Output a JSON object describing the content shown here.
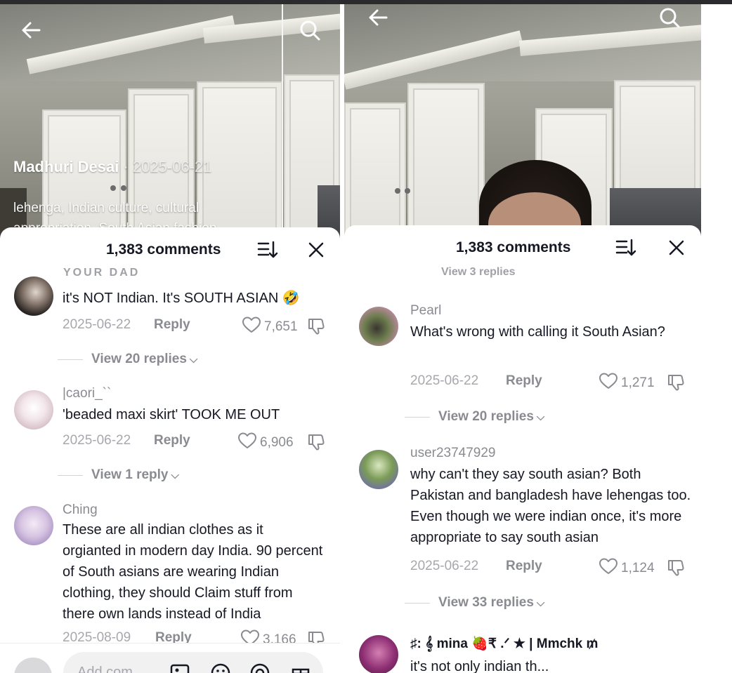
{
  "colors": {
    "accent_text": "#161823",
    "muted_text": "#8a8b91",
    "meta_text": "#a7a8ad",
    "sheet_bg": "#ffffff"
  },
  "left": {
    "video": {
      "author": "Madhuri Desai",
      "date": "· 2025-06-21",
      "tags": "lehenga, Indian culture, cultural appropriation, South Asian fashion,"
    },
    "header": {
      "title": "1,383 comments"
    },
    "cut_username": "YOUR DAD",
    "comments": [
      {
        "username": "",
        "text": "it's NOT Indian. It's SOUTH ASIAN 🤣",
        "date": "2025-06-22",
        "reply": "Reply",
        "likes": "7,651",
        "view_replies": "View 20 replies"
      },
      {
        "username": "|caori_``",
        "text": "'beaded maxi skirt' TOOK ME OUT",
        "date": "2025-06-22",
        "reply": "Reply",
        "likes": "6,906",
        "view_replies": "View 1 reply"
      },
      {
        "username": "Ching",
        "text": "These are all indian clothes as it orgianted in modern day India. 90 percent of South asians are wearing Indian clothing, they should Claim stuff from there own lands instead of India",
        "date": "2025-08-09",
        "reply": "Reply",
        "likes": "3,166"
      }
    ],
    "input": {
      "placeholder": "Add com..."
    }
  },
  "right": {
    "header": {
      "title": "1,383 comments"
    },
    "cut_replies": "View 3 replies",
    "comments": [
      {
        "username": "Pearl",
        "text": "What's wrong with calling it South Asian?",
        "date": "2025-06-22",
        "reply": "Reply",
        "likes": "1,271",
        "view_replies": "View 20 replies"
      },
      {
        "username": "user23747929",
        "text": "why can't they say south asian? Both Pakistan and bangladesh have lehengas too. Even though we were indian once, it's more appropriate to say south asian",
        "date": "2025-06-22",
        "reply": "Reply",
        "likes": "1,124",
        "view_replies": "View 33 replies"
      },
      {
        "username": "♯: 𝄞 mina 🍓₹ .ᐟ ★ | Mmchk ₥",
        "text": "it's not only indian th..."
      }
    ]
  },
  "icons": {
    "back": "arrow-left-icon",
    "search": "search-icon",
    "sort": "sort-icon",
    "close": "close-icon",
    "like": "heart-icon",
    "dislike": "dislike-icon",
    "image": "image-icon",
    "emoji": "emoji-icon",
    "mention": "at-icon",
    "gift": "gift-icon"
  }
}
